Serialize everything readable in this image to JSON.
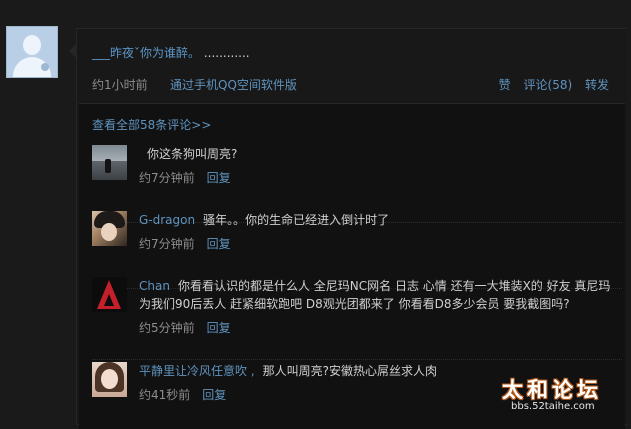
{
  "post": {
    "author": "___昨夜ˇ你为谁醉。",
    "text": " ............",
    "time": "约1小时前",
    "via": "通过手机QQ空间软件版",
    "like": "赞",
    "comments": "评论(58)",
    "forward": "转发"
  },
  "comments_section": {
    "view_all": "查看全部58条评论>>",
    "items": [
      {
        "name": "",
        "text": "你这条狗叫周亮?",
        "time": "约7分钟前",
        "reply": "回复"
      },
      {
        "name": "G-dragon",
        "text": "骚年。。你的生命已经进入倒计时了",
        "time": "约7分钟前",
        "reply": "回复"
      },
      {
        "name": "Chan",
        "text": "你看看认识的都是什么人 全尼玛NC网名 日志 心情 还有一大堆装X的 好友 真尼玛为我们90后丢人 赶紧细软跑吧 D8观光团都来了 你看看D8多少会员 要我截图吗?",
        "time": "约5分钟前",
        "reply": "回复"
      },
      {
        "name": "平静里让冷风任意吹 ,",
        "text": "那人叫周亮?安徽热心屌丝求人肉",
        "time": "约41秒前",
        "reply": "回复"
      }
    ]
  },
  "watermark": {
    "title": "太和论坛",
    "url": "bbs.52taihe.com"
  },
  "colors": {
    "background": "#1a1a1a",
    "link": "#5f93be",
    "text": "#d0d0d0",
    "muted": "#8d8d8d"
  }
}
